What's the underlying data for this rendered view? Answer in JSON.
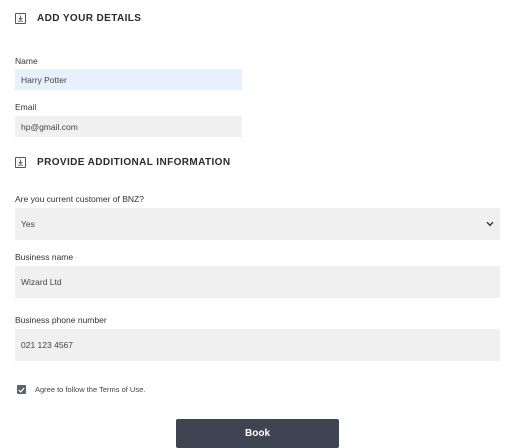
{
  "sections": {
    "details_title": "ADD YOUR DETAILS",
    "additional_title": "PROVIDE ADDITIONAL INFORMATION"
  },
  "fields": {
    "name": {
      "label": "Name",
      "value": "Harry Potter"
    },
    "email": {
      "label": "Email",
      "value": "hp@gmail.com"
    },
    "customer": {
      "label": "Are you current customer of BNZ?",
      "value": "Yes"
    },
    "business_name": {
      "label": "Business name",
      "value": "Wizard Ltd"
    },
    "business_phone": {
      "label": "Business phone number",
      "value": "021 123 4567"
    }
  },
  "terms": {
    "label": "Agree to follow the Terms of Use.",
    "checked": true
  },
  "book_button": {
    "label": "Book"
  },
  "colors": {
    "field_bg": "#f0f0f0",
    "autofill_bg": "#e8f0fe",
    "button_bg": "#3e4452",
    "checkbox_bg": "#5c6370"
  },
  "icons": {
    "section": "download-box-icon",
    "dropdown": "chevron-down-icon",
    "checkbox": "check-icon"
  }
}
